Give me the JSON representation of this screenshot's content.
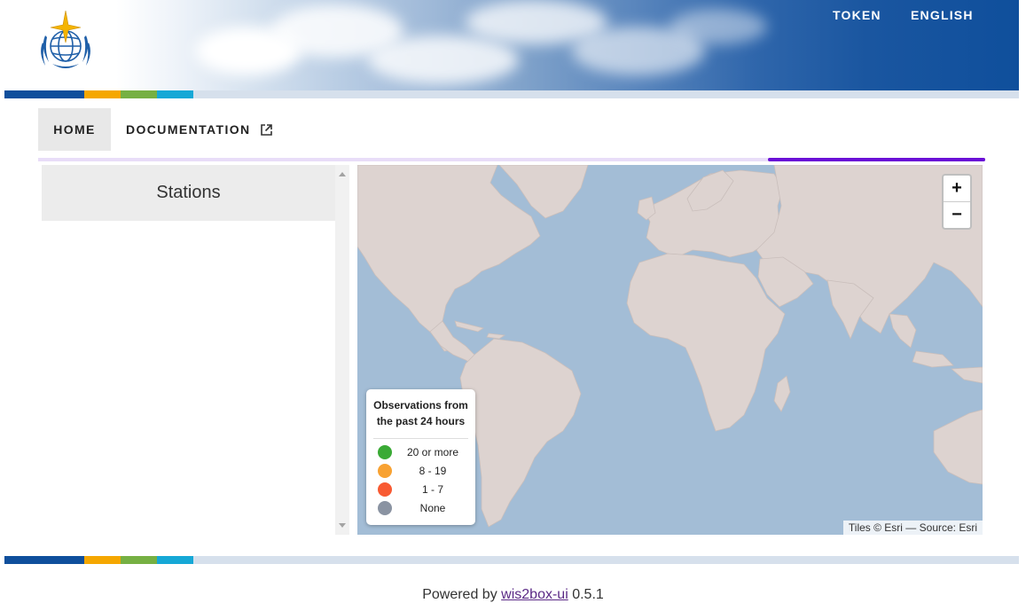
{
  "header": {
    "logo_icon": "wmo-emblem-icon",
    "nav": {
      "token": "TOKEN",
      "language": "ENGLISH"
    }
  },
  "stripe_colors": [
    "#0f4f9c",
    "#f5a700",
    "#76b043",
    "#16a8d6",
    "#d6e0ec"
  ],
  "tabs": [
    {
      "label": "HOME",
      "active": true
    },
    {
      "label": "DOCUMENTATION",
      "icon": "open-in-new-icon"
    }
  ],
  "accent_color": "#6a0dd6",
  "stations": {
    "title": "Stations"
  },
  "map": {
    "zoom_in": "+",
    "zoom_out": "−",
    "legend": {
      "title_line1": "Observations from",
      "title_line2": "the past 24 hours",
      "items": [
        {
          "label": "20 or more",
          "color": "#3aaa35"
        },
        {
          "label": "8 - 19",
          "color": "#f8a232"
        },
        {
          "label": "1 - 7",
          "color": "#f85a32"
        },
        {
          "label": "None",
          "color": "#8a93a2"
        }
      ]
    },
    "attribution": "Tiles © Esri — Source: Esri"
  },
  "footer": {
    "prefix": "Powered by",
    "link": "wis2box-ui",
    "version": "0.5.1"
  }
}
